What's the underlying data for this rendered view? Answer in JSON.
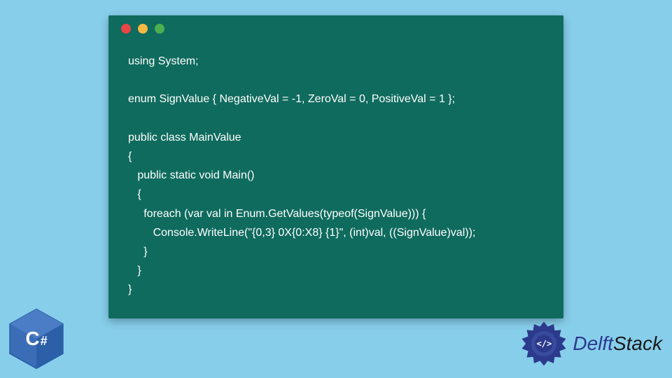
{
  "code": {
    "line1": "using System;",
    "line2": "",
    "line3": "enum SignValue { NegativeVal = -1, ZeroVal = 0, PositiveVal = 1 };",
    "line4": "",
    "line5": "public class MainValue",
    "line6": "{",
    "line7": "   public static void Main()",
    "line8": "   {",
    "line9": "     foreach (var val in Enum.GetValues(typeof(SignValue))) {",
    "line10": "        Console.WriteLine(\"{0,3} 0X{0:X8} {1}\", (int)val, ((SignValue)val));",
    "line11": "     }",
    "line12": "   }",
    "line13": "}"
  },
  "badges": {
    "csharp": {
      "letter": "C",
      "sharp": "#"
    },
    "delftstack": {
      "code_symbol": "</>",
      "text_delft": "Delft",
      "text_stack": "Stack"
    }
  },
  "colors": {
    "background": "#87ceeb",
    "code_window": "#0f6b5e",
    "csharp_badge": "#2b5fa8",
    "delft_blue": "#2b3a8c"
  }
}
